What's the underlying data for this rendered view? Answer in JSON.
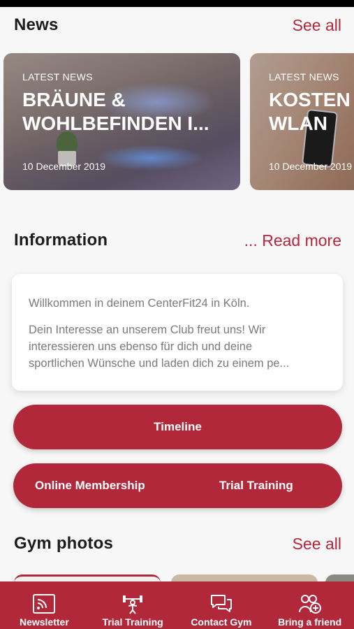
{
  "news": {
    "title": "News",
    "see_all": "See all",
    "cards": [
      {
        "tag": "LATEST NEWS",
        "headline": "BRÄUNE &\nWOHLBEFINDEN I...",
        "date": "10 December 2019"
      },
      {
        "tag": "LATEST NEWS",
        "headline": "KOSTEN\nWLAN",
        "date": "10 December 2019"
      }
    ]
  },
  "information": {
    "title": "Information",
    "read_more": "... Read more",
    "lines": [
      "Willkommen in deinem CenterFit24 in Köln.",
      "Dein Interesse an unserem Club freut uns! Wir",
      "interessieren uns ebenso für dich und deine",
      "sportlichen Wünsche und laden dich zu einem pe..."
    ]
  },
  "buttons": {
    "timeline": "Timeline",
    "online_membership": "Online Membership",
    "trial_training": "Trial Training"
  },
  "gym_photos": {
    "title": "Gym photos",
    "see_all": "See all"
  },
  "bottom_nav": [
    {
      "label": "Newsletter",
      "icon": "newsletter-icon"
    },
    {
      "label": "Trial Training",
      "icon": "trial-training-icon"
    },
    {
      "label": "Contact Gym",
      "icon": "contact-gym-icon"
    },
    {
      "label": "Bring a friend",
      "icon": "bring-a-friend-icon"
    }
  ],
  "colors": {
    "accent": "#b1283a",
    "background": "#f7f7f7",
    "text": "#1c1c1c",
    "muted_text": "#7a7a7a"
  }
}
